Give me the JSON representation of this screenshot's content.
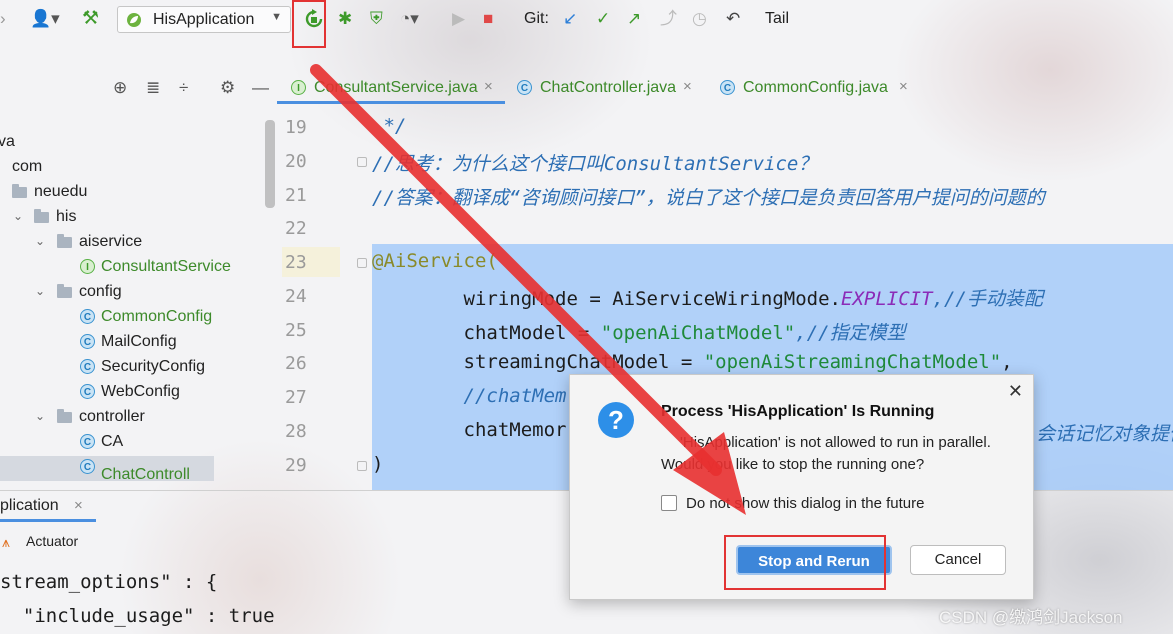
{
  "toolbar": {
    "run_config": "HisApplication",
    "git_label": "Git:",
    "tail_label": "Tail",
    "icons": [
      "user-icon",
      "hammer-icon",
      "rerun-icon",
      "debug-icon",
      "coverage-icon",
      "profile-icon",
      "run-icon",
      "stop-icon",
      "git-update-icon",
      "git-commit-icon",
      "git-push-icon",
      "history-icon",
      "rollback-icon"
    ]
  },
  "editor_tabs": [
    {
      "label": "ConsultantService.java",
      "kind": "I",
      "active": true
    },
    {
      "label": "ChatController.java",
      "kind": "C",
      "active": false
    },
    {
      "label": "CommonConfig.java",
      "kind": "C",
      "active": false
    }
  ],
  "tree": {
    "items": [
      {
        "label": "va"
      },
      {
        "label": "com"
      },
      {
        "label": "neuedu"
      },
      {
        "label": "his"
      },
      {
        "label": "aiservice"
      },
      {
        "label": "ConsultantService"
      },
      {
        "label": "config"
      },
      {
        "label": "CommonConfig"
      },
      {
        "label": "MailConfig"
      },
      {
        "label": "SecurityConfig"
      },
      {
        "label": "WebConfig"
      },
      {
        "label": "controller"
      },
      {
        "label": "CA"
      },
      {
        "label": "ChatControll"
      }
    ]
  },
  "editor": {
    "line_numbers": [
      "19",
      "20",
      "21",
      "22",
      "23",
      "24",
      "25",
      "26",
      "27",
      "28",
      "29"
    ],
    "lines": {
      "l19": " */",
      "l20": "//思考：为什么这个接口叫ConsultantService？",
      "l21": "//答案：翻译成“咨询顾问接口”，说白了这个接口是负责回答用户提问的问题的",
      "l23": "@AiService(",
      "l24a": "        wiringMode = AiServiceWiringMode.",
      "l24b": "EXPLICIT",
      "l24c": ",//手动装配",
      "l25a": "        chatModel = ",
      "l25b": "\"openAiChatModel\"",
      "l25c": ",//指定模型",
      "l26a": "        streamingChatModel = ",
      "l26b": "\"openAiStreamingChatModel\"",
      "l26c": ",",
      "l27": "        //chatMem",
      "l28a": "        chatMemor",
      "l28b": "会话记忆对象提供",
      "l29": ")"
    }
  },
  "run_panel": {
    "tab_label": "plication",
    "actuator_label": "Actuator",
    "console": [
      "stream_options\" : {",
      "  \"include_usage\" : true"
    ]
  },
  "dialog": {
    "title": "Process 'HisApplication' Is Running",
    "message_1": "'HisApplication' is not allowed to run in parallel.",
    "message_2": "Would you like to stop the running one?",
    "checkbox_label": "Do not show this dialog in the future",
    "primary_button": "Stop and Rerun",
    "cancel_button": "Cancel",
    "close_glyph": "✕",
    "icon_glyph": "?"
  },
  "watermark": "CSDN @缴鸿剑Jackson",
  "colors": {
    "accent": "#3d86d9",
    "annotation_red": "#e23333",
    "string_green": "#1f8a3a",
    "comment_blue": "#2d6fb4"
  }
}
